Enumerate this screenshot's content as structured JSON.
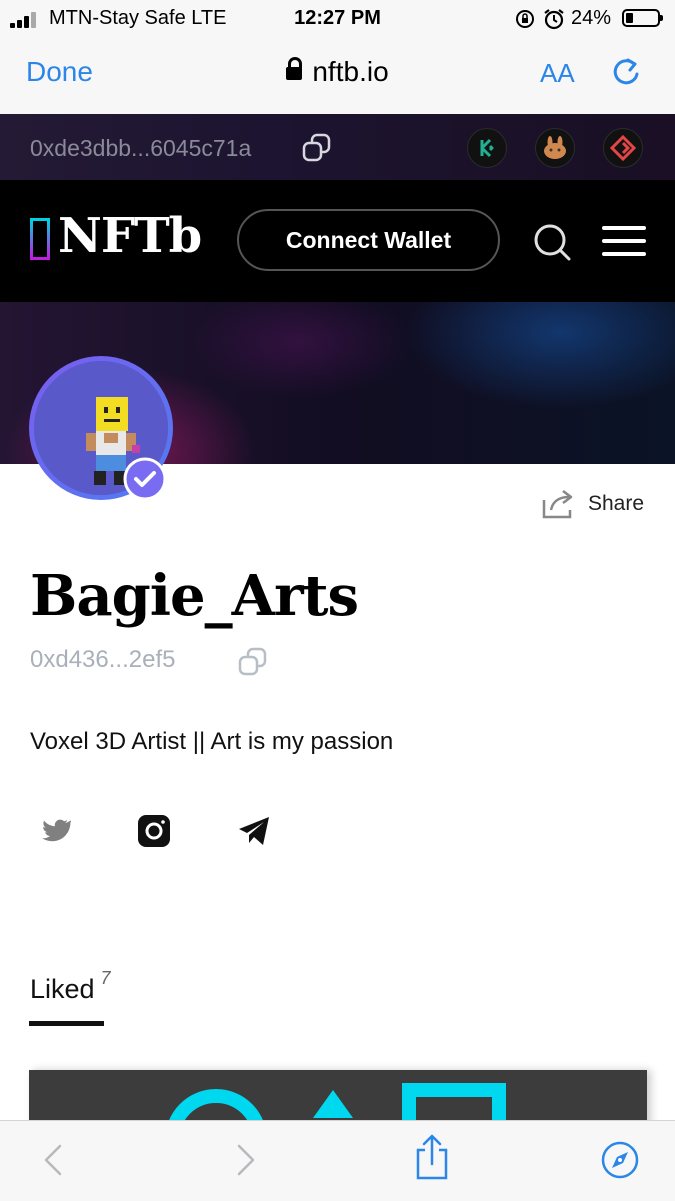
{
  "status_bar": {
    "carrier": "MTN-Stay Safe  LTE",
    "time": "12:27 PM",
    "battery": "24%",
    "battery_level": 0.24
  },
  "safari": {
    "done_label": "Done",
    "url": "nftb.io",
    "text_size_label": "AA"
  },
  "wallet": {
    "address": "0xde3dbb...6045c71a",
    "chains": [
      {
        "name": "kucoin-icon",
        "color": "#23af91"
      },
      {
        "name": "pancakeswap-icon",
        "color": "#d1884f"
      },
      {
        "name": "gate-icon",
        "color": "#e64545"
      }
    ]
  },
  "header": {
    "logo_text": "NFTb",
    "connect_wallet_label": "Connect Wallet"
  },
  "profile": {
    "share_label": "Share",
    "name": "Bagie_Arts",
    "address": "0xd436...2ef5",
    "bio": "Voxel 3D Artist || Art is my passion",
    "verified": true,
    "socials": [
      "twitter-icon",
      "instagram-icon",
      "telegram-icon"
    ]
  },
  "tabs": {
    "liked_label": "Liked",
    "liked_count": "7"
  },
  "colors": {
    "ios_blue": "#2b86e8",
    "verify_badge": "#7a6cf2",
    "card_accent": "#00d8f0"
  }
}
